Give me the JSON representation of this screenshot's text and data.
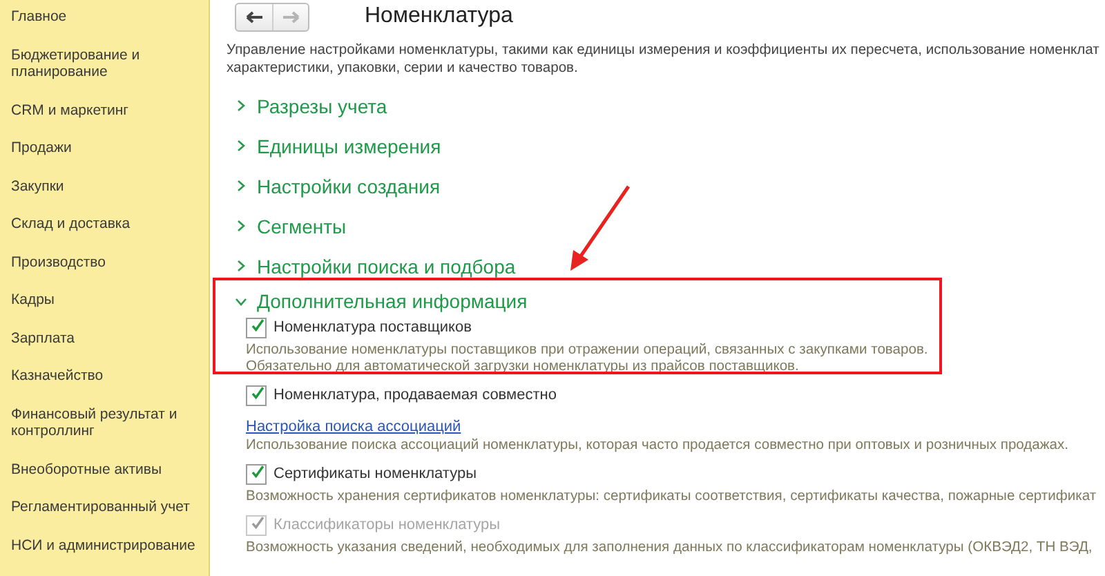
{
  "sidebar": {
    "items": [
      {
        "label": "Главное"
      },
      {
        "label": "Бюджетирование и планирование"
      },
      {
        "label": "CRM и маркетинг"
      },
      {
        "label": "Продажи"
      },
      {
        "label": "Закупки"
      },
      {
        "label": "Склад и доставка"
      },
      {
        "label": "Производство"
      },
      {
        "label": "Кадры"
      },
      {
        "label": "Зарплата"
      },
      {
        "label": "Казначейство"
      },
      {
        "label": "Финансовый результат и контроллинг"
      },
      {
        "label": "Внеоборотные активы"
      },
      {
        "label": "Регламентированный учет"
      },
      {
        "label": "НСИ и администрирование"
      }
    ]
  },
  "toolbar": {
    "back_disabled": false,
    "forward_disabled": true
  },
  "title": "Номенклатура",
  "description": [
    "Управление настройками номенклатуры, такими как единицы измерения и коэффициенты их пересчета, использование номенклат",
    "характеристики, упаковки, серии и качество товаров."
  ],
  "sections": [
    {
      "title": "Разрезы учета",
      "expanded": false
    },
    {
      "title": "Единицы измерения",
      "expanded": false
    },
    {
      "title": "Настройки создания",
      "expanded": false
    },
    {
      "title": "Сегменты",
      "expanded": false
    },
    {
      "title": "Настройки поиска и подбора",
      "expanded": false
    },
    {
      "title": "Дополнительная информация",
      "expanded": true,
      "options": [
        {
          "kind": "checkbox",
          "label": "Номенклатура поставщиков",
          "checked": true,
          "disabled": false,
          "description": [
            "Использование номенклатуры поставщиков при отражении операций, связанных с закупками товаров.",
            "Обязательно для автоматической загрузки номенклатуры из прайсов поставщиков."
          ]
        },
        {
          "kind": "checkbox",
          "label": "Номенклатура, продаваемая совместно",
          "checked": true,
          "disabled": false
        },
        {
          "kind": "link",
          "label": "Настройка поиска ассоциаций",
          "description": [
            "Использование поиска ассоциаций номенклатуры, которая часто продается совместно при оптовых и розничных продажах."
          ]
        },
        {
          "kind": "checkbox",
          "label": "Сертификаты номенклатуры",
          "checked": true,
          "disabled": false,
          "description": [
            "Возможность хранения сертификатов номенклатуры: сертификаты соответствия, сертификаты качества, пожарные сертификат"
          ]
        },
        {
          "kind": "checkbox",
          "label": "Классификаторы номенклатуры",
          "checked": true,
          "disabled": true,
          "description": [
            "Возможность указания сведений, необходимых для заполнения данных по классификаторам номенклатуры (ОКВЭД2, ТН ВЭД,"
          ]
        }
      ]
    }
  ]
}
